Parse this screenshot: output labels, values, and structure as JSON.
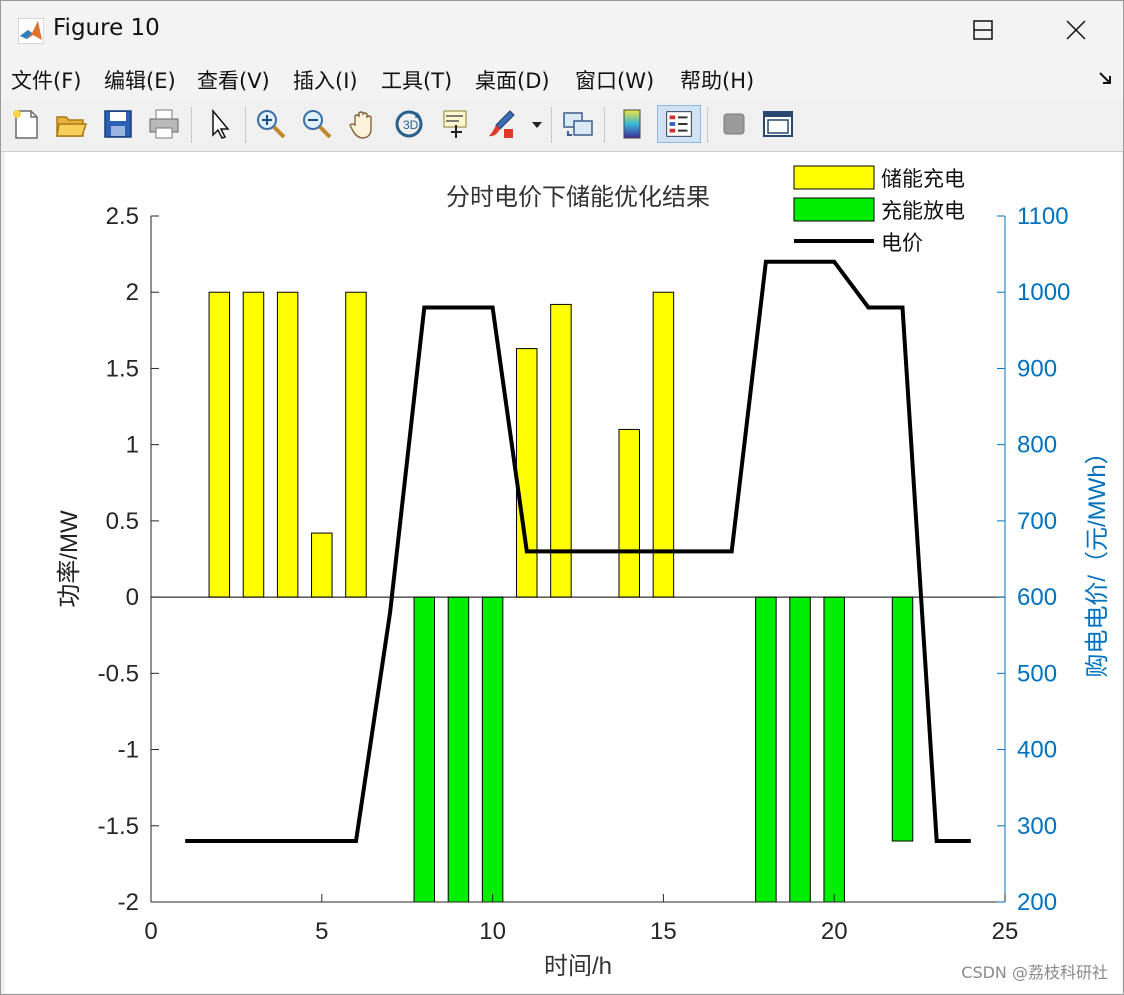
{
  "window": {
    "title": "Figure 10"
  },
  "menu": [
    "文件(F)",
    "编辑(E)",
    "查看(V)",
    "插入(I)",
    "工具(T)",
    "桌面(D)",
    "窗口(W)",
    "帮助(H)"
  ],
  "toolbar": [
    "new-file-icon",
    "open-folder-icon",
    "save-icon",
    "print-icon",
    "pointer-icon",
    "zoom-in-icon",
    "zoom-out-icon",
    "pan-hand-icon",
    "rotate-3d-icon",
    "data-cursor-icon",
    "brush-icon",
    "link-plot-icon",
    "colorbar-icon",
    "legend-icon",
    "hide-tools-icon",
    "show-tools-icon"
  ],
  "watermark": "CSDN @荔枝科研社",
  "chart_data": {
    "type": "bar",
    "title": "分时电价下储能优化结果",
    "xlabel": "时间/h",
    "ylabel": "功率/MW",
    "y2label": "购电电价/（元/MWh）",
    "xlim": [
      0,
      25
    ],
    "ylim": [
      -2,
      2.5
    ],
    "y2lim": [
      200,
      1100
    ],
    "xticks": [
      0,
      5,
      10,
      15,
      20,
      25
    ],
    "yticks": [
      -2,
      -1.5,
      -1,
      -0.5,
      0,
      0.5,
      1,
      1.5,
      2,
      2.5
    ],
    "y2ticks": [
      200,
      300,
      400,
      500,
      600,
      700,
      800,
      900,
      1000,
      1100
    ],
    "legend_position": "top-right",
    "colors": {
      "charge": "#ffff00",
      "discharge": "#00ee00",
      "price": "#000000",
      "right_axis": "#0072bd"
    },
    "series": [
      {
        "name": "储能充电",
        "type": "bar",
        "x": [
          2,
          3,
          4,
          5,
          6,
          11,
          12,
          14,
          15
        ],
        "values": [
          2,
          2,
          2,
          0.42,
          2,
          1.63,
          1.92,
          1.1,
          2
        ]
      },
      {
        "name": "充能放电",
        "type": "bar",
        "x": [
          8,
          9,
          10,
          18,
          19,
          20,
          22
        ],
        "values": [
          -2,
          -2,
          -2,
          -2,
          -2,
          -2,
          -1.6
        ]
      },
      {
        "name": "电价",
        "type": "line",
        "axis": "right",
        "x": [
          1,
          2,
          3,
          4,
          5,
          6,
          7,
          8,
          9,
          10,
          11,
          12,
          13,
          14,
          15,
          16,
          17,
          18,
          19,
          20,
          21,
          22,
          23,
          24
        ],
        "values": [
          280,
          280,
          280,
          280,
          280,
          280,
          580,
          980,
          980,
          980,
          660,
          660,
          660,
          660,
          660,
          660,
          660,
          1040,
          1040,
          1040,
          980,
          980,
          280,
          280
        ]
      }
    ]
  }
}
